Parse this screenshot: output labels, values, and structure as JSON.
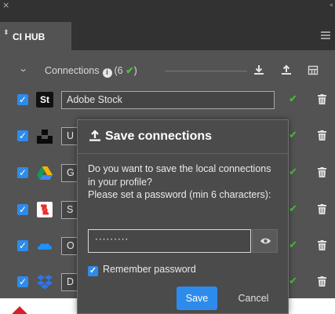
{
  "window": {
    "close_glyph": "×",
    "collapse_glyph": "‹‹"
  },
  "tab": {
    "label": "CI HUB",
    "arrows_glyph": "⬍"
  },
  "connections": {
    "title": "Connections",
    "count_text": "(6 ",
    "count_close": ")",
    "info_glyph": "i",
    "check_glyph": "✔"
  },
  "rows": [
    {
      "label": "Adobe Stock",
      "logo": "adobe-stock-logo",
      "logo_text": "St",
      "checked": true,
      "connected": true
    },
    {
      "label": "U",
      "logo": "unsplash-logo",
      "checked": true,
      "connected": true
    },
    {
      "label": "G",
      "logo": "google-drive-logo",
      "checked": true,
      "connected": true
    },
    {
      "label": "S",
      "logo": "shutterstock-logo",
      "checked": true,
      "connected": true
    },
    {
      "label": "O",
      "logo": "onedrive-logo",
      "checked": true,
      "connected": true
    },
    {
      "label": "D",
      "logo": "dropbox-logo",
      "checked": true,
      "connected": true
    }
  ],
  "dialog": {
    "title": "Save connections",
    "message": "Do you want to save the local connections in your profile?\nPlease set a password (min 6 characters):",
    "password_value": "·········",
    "remember_label": "Remember password",
    "remember_checked": true,
    "save_label": "Save",
    "cancel_label": "Cancel"
  },
  "colors": {
    "accent": "#2d8ceb",
    "success": "#4cc13c",
    "panel": "#535353",
    "dark": "#323232"
  },
  "icons": {
    "download": "download-icon",
    "upload": "upload-icon",
    "settings": "grid-settings-icon",
    "trash": "trash-icon",
    "eye": "eye-icon",
    "menu": "hamburger-menu-icon"
  }
}
